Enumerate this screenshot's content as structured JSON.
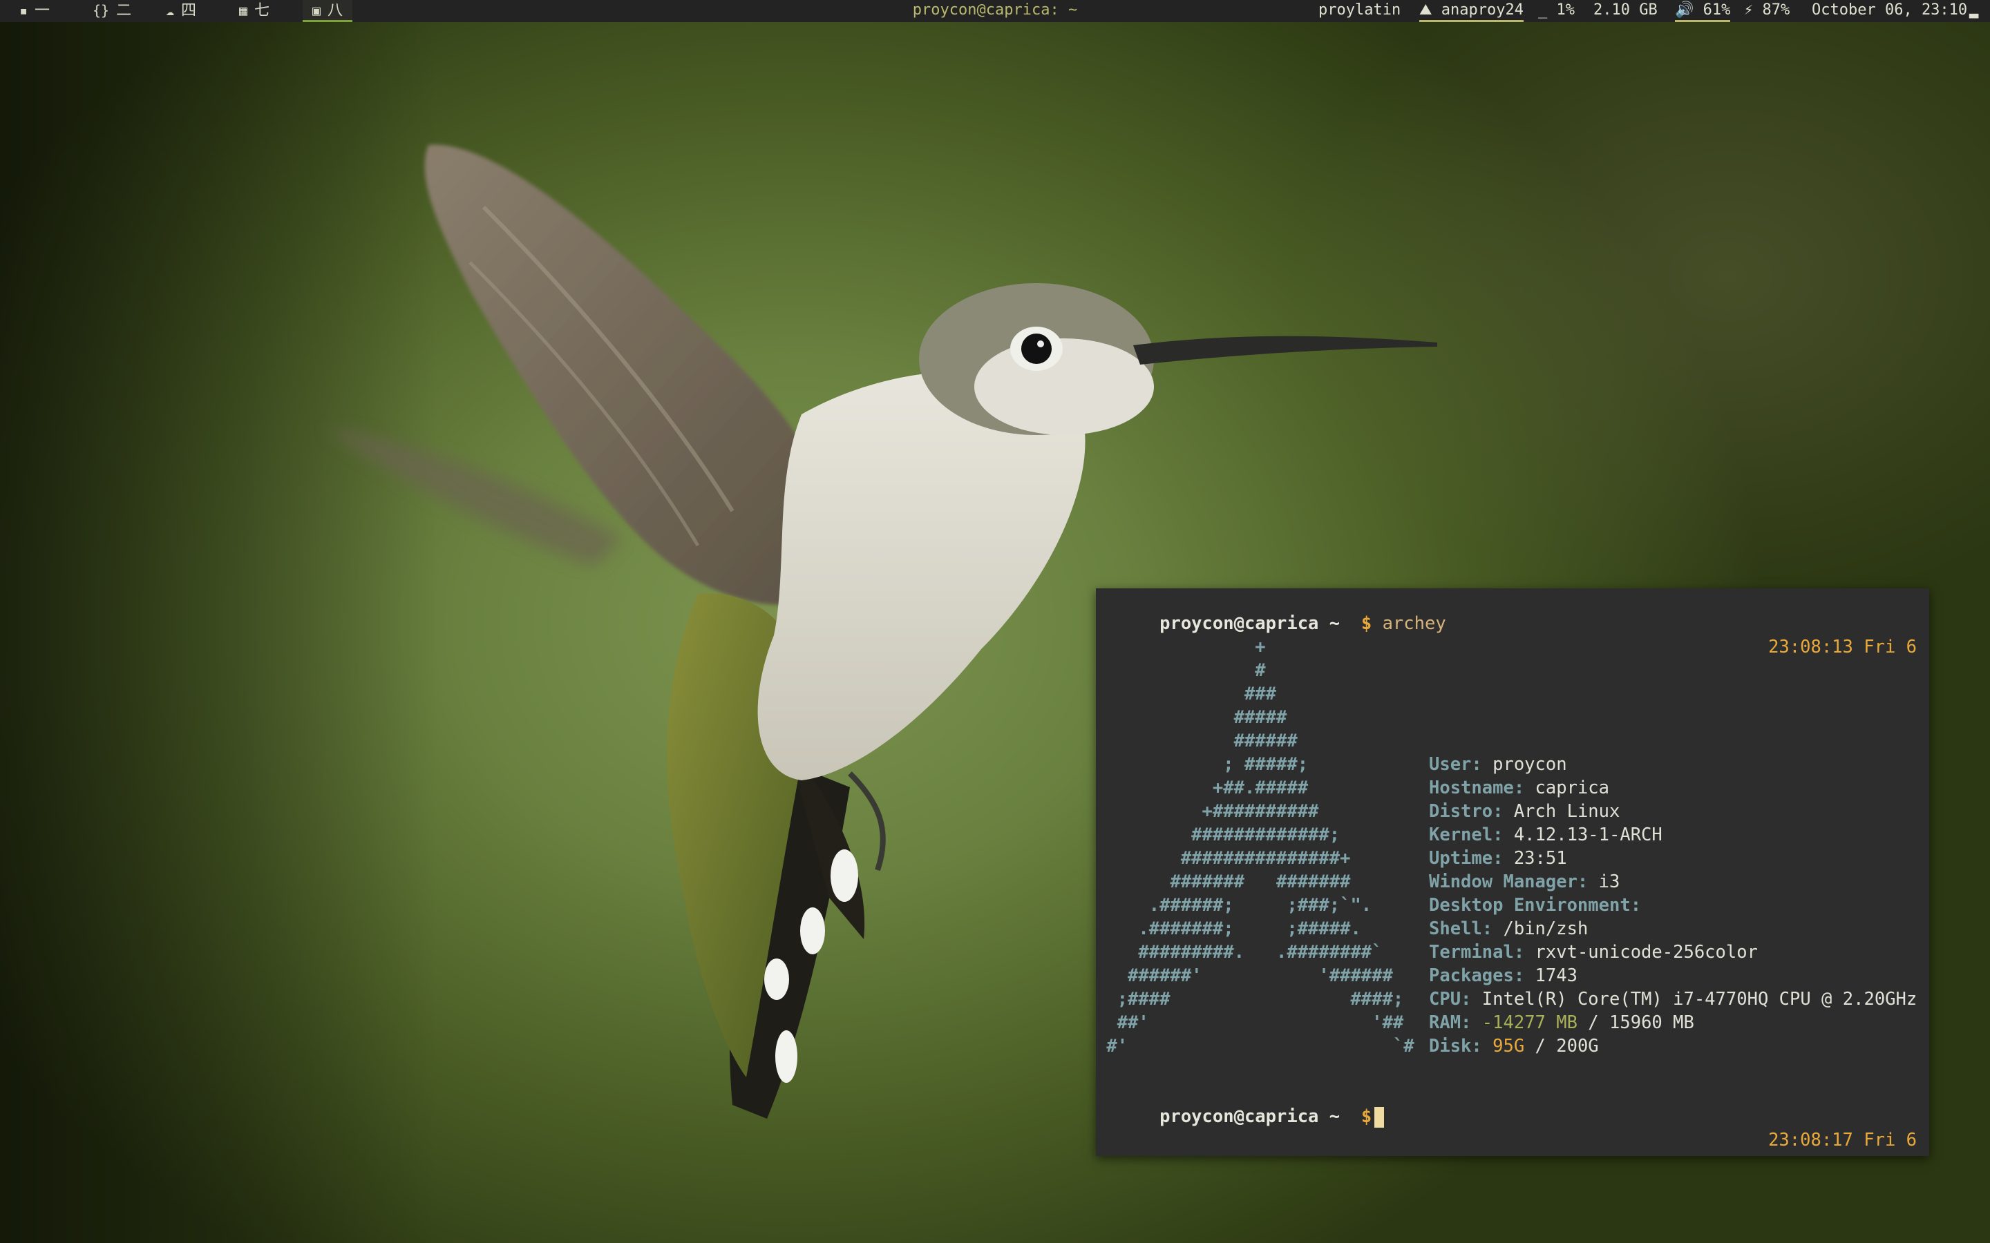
{
  "topbar": {
    "workspaces": [
      {
        "icon": "chat-icon",
        "glyph": "▪",
        "label": "一",
        "active": false
      },
      {
        "icon": "code-braces-icon",
        "glyph": "{}",
        "label": "二",
        "active": false
      },
      {
        "icon": "cloud-icon",
        "glyph": "☁",
        "label": "四",
        "active": false
      },
      {
        "icon": "table-grid-icon",
        "glyph": "▦",
        "label": "七",
        "active": false
      },
      {
        "icon": "terminal-icon",
        "glyph": "▣",
        "label": "八",
        "active": true
      }
    ],
    "window_title": "proycon@caprica: ~",
    "status": {
      "vpn": "proylatin",
      "network_icon": "chart-area-icon",
      "network": "anaproy24",
      "cpu_icon": "underscore-icon",
      "cpu": "1%",
      "memory": "2.10 GB",
      "volume_icon": "speaker-icon",
      "volume": "61%",
      "battery_icon": "battery-bolt-icon",
      "battery": "87%",
      "datetime": "October 06, 23:10",
      "wifi_icon": "signal-bars-icon"
    }
  },
  "terminal": {
    "prompt_user": "proycon@caprica ~",
    "prompt_symbol": "$",
    "command": "archey",
    "command_time": "23:08:13 Fri 6",
    "logo_lines": [
      "               +",
      "               #",
      "              ###",
      "             #####",
      "             ######",
      "            ; #####;",
      "           +##.#####",
      "          +##########",
      "         #############;",
      "        ###############+",
      "       #######   #######",
      "     .######;     ;###;`\".",
      "    .#######;     ;#####.",
      "    #########.   .########`",
      "   ######'           '######",
      "  ;####                 ####;",
      "  ##'                     '##",
      " #'                         `#"
    ],
    "info": [
      {
        "key": "User:",
        "value": "proycon"
      },
      {
        "key": "Hostname:",
        "value": "caprica"
      },
      {
        "key": "Distro:",
        "value": "Arch Linux"
      },
      {
        "key": "Kernel:",
        "value": "4.12.13-1-ARCH"
      },
      {
        "key": "Uptime:",
        "value": "23:51"
      },
      {
        "key": "Window Manager:",
        "value": "i3"
      },
      {
        "key": "Desktop Environment:",
        "value": ""
      },
      {
        "key": "Shell:",
        "value": "/bin/zsh"
      },
      {
        "key": "Terminal:",
        "value": "rxvt-unicode-256color"
      },
      {
        "key": "Packages:",
        "value": "1743"
      },
      {
        "key": "CPU:",
        "value": "Intel(R) Core(TM) i7-4770HQ CPU @ 2.20GHz"
      }
    ],
    "ram": {
      "key": "RAM:",
      "used": "-14277 MB",
      "sep": " / ",
      "total": "15960 MB"
    },
    "disk": {
      "key": "Disk:",
      "used": "95G",
      "sep": " / ",
      "total": "200G"
    },
    "second_prompt_time": "23:08:17 Fri 6"
  },
  "colors": {
    "bar_bg": "#232323",
    "active_underline": "#7ea23c",
    "terminal_bg": "#2d2d2d",
    "accent_orange": "#e8a93a",
    "logo_teal": "#7fa3a8"
  }
}
